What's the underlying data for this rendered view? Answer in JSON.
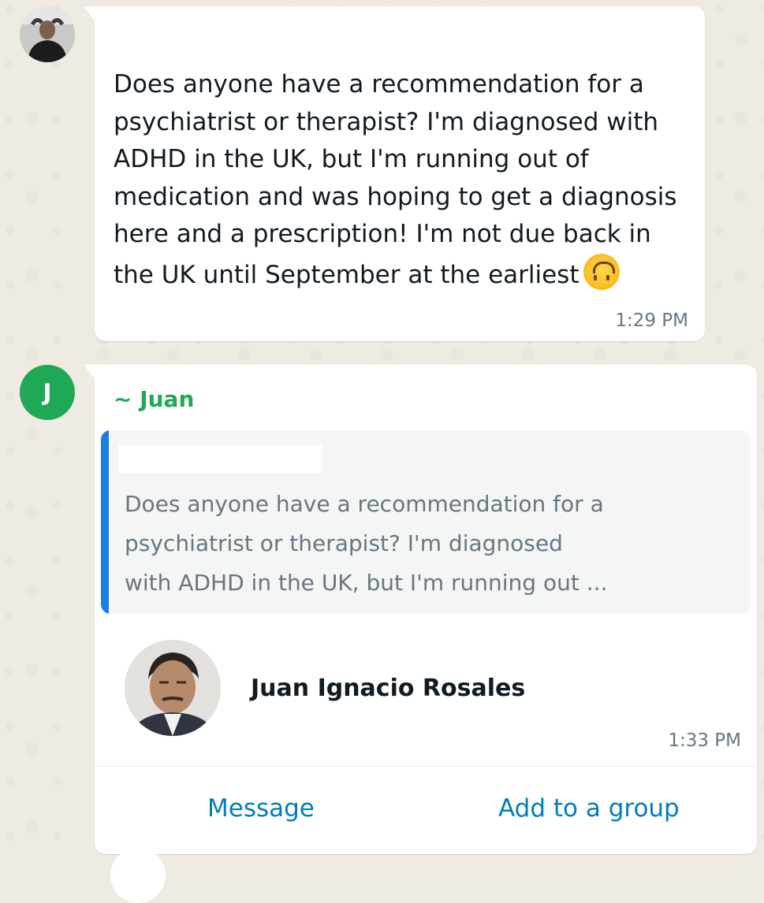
{
  "messages": [
    {
      "text": "Does anyone have a recommendation for a psychiatrist or therapist? I'm diagnosed with ADHD in the UK, but I'm running out of medication and was hoping to get a diagnosis here and a prescription! I'm not due back in the UK until September at the earliest",
      "emoji": "upside-down-face-emoji",
      "time": "1:29 PM"
    },
    {
      "avatar_letter": "J",
      "sender": "~ Juan",
      "quoted_text": "Does anyone have a recommendation for a\npsychiatrist or therapist? I'm diagnosed\nwith ADHD in the UK, but I'm running out ...",
      "contact_name": "Juan Ignacio Rosales",
      "time": "1:33 PM",
      "actions": {
        "message": "Message",
        "add_to_group": "Add to a group"
      }
    }
  ],
  "colors": {
    "background": "#efeae2",
    "bubble": "#ffffff",
    "sender_green": "#1fa855",
    "quote_bar": "#1d7de3",
    "action_link": "#027eb5",
    "timestamp": "#667781"
  }
}
